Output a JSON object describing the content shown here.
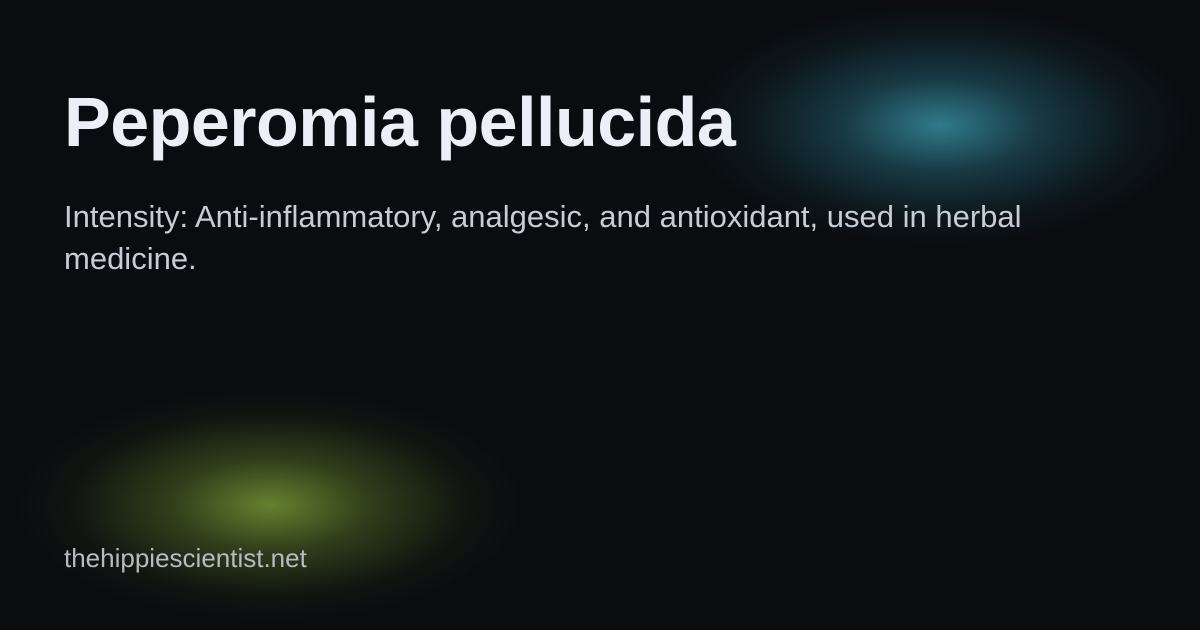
{
  "card": {
    "title": "Peperomia pellucida",
    "description": "Intensity: Anti-inflammatory, analgesic, and antioxidant, used in herbal medicine.",
    "site": "thehippiescientist.net"
  },
  "colors": {
    "background": "#0a0c0f",
    "title": "#eceff5",
    "body_text": "#c8ccd4",
    "glow_teal": "#3a96aa",
    "glow_green": "#769634"
  }
}
